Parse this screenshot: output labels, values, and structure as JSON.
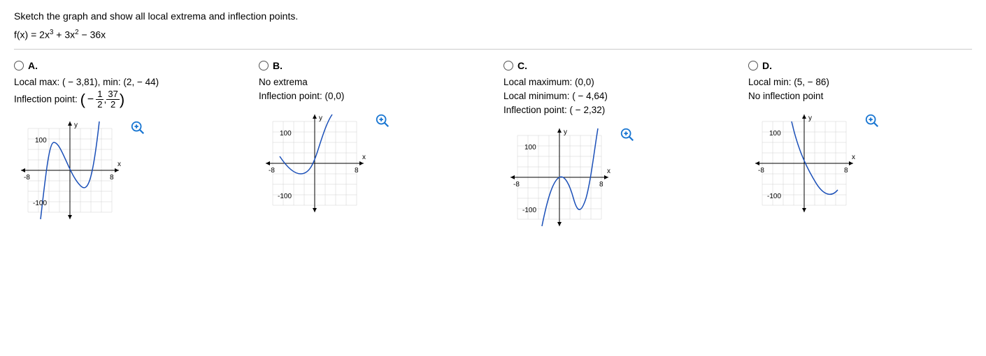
{
  "prompt": "Sketch the graph and show all local extrema and inflection points.",
  "formula_plain": "f(x) = 2x³ + 3x² − 36x",
  "options": {
    "A": {
      "letter": "A.",
      "line1": "Local max: ( − 3,81), min: (2, − 44)",
      "inflection_prefix": "Inflection point:",
      "frac": {
        "num1": "1",
        "den1": "2",
        "num2": "37",
        "den2": "2"
      }
    },
    "B": {
      "letter": "B.",
      "line1": "No extrema",
      "line2": "Inflection point: (0,0)"
    },
    "C": {
      "letter": "C.",
      "line1": "Local maximum: (0,0)",
      "line2": "Local minimum: ( − 4,64)",
      "line3": "Inflection point: ( − 2,32)"
    },
    "D": {
      "letter": "D.",
      "line1": "Local min: (5, − 86)",
      "line2": "No inflection point"
    }
  },
  "axis": {
    "pos_y": "100",
    "neg_y": "-100",
    "pos_x": "8",
    "neg_x": "-8",
    "x_label": "x",
    "y_label": "y"
  },
  "chart_data": [
    {
      "option": "A",
      "type": "line",
      "title": "",
      "xlabel": "x",
      "ylabel": "y",
      "xlim": [
        -8,
        8
      ],
      "ylim": [
        -120,
        120
      ],
      "series": [
        {
          "name": "f",
          "function": "2x^3+3x^2-36x"
        }
      ],
      "local_max": [
        -3,
        81
      ],
      "local_min": [
        2,
        -44
      ],
      "inflection": [
        -0.5,
        18.5
      ]
    },
    {
      "option": "B",
      "type": "line",
      "title": "",
      "xlabel": "x",
      "ylabel": "y",
      "xlim": [
        -8,
        8
      ],
      "ylim": [
        -120,
        120
      ],
      "series": [
        {
          "name": "f"
        }
      ],
      "extrema": "none",
      "inflection": [
        0,
        0
      ]
    },
    {
      "option": "C",
      "type": "line",
      "title": "",
      "xlabel": "x",
      "ylabel": "y",
      "xlim": [
        -8,
        8
      ],
      "ylim": [
        -120,
        120
      ],
      "series": [
        {
          "name": "f"
        }
      ],
      "local_max": [
        0,
        0
      ],
      "local_min": [
        -4,
        64
      ],
      "inflection": [
        -2,
        32
      ]
    },
    {
      "option": "D",
      "type": "line",
      "title": "",
      "xlabel": "x",
      "ylabel": "y",
      "xlim": [
        -8,
        8
      ],
      "ylim": [
        -120,
        120
      ],
      "series": [
        {
          "name": "f"
        }
      ],
      "local_min": [
        5,
        -86
      ],
      "inflection": "none"
    }
  ]
}
